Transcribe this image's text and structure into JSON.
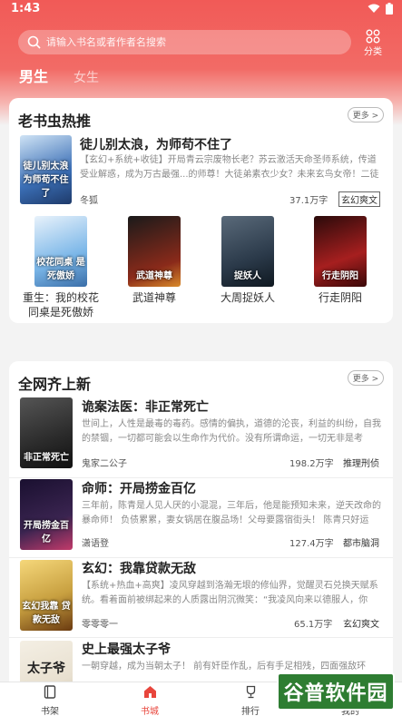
{
  "status": {
    "time": "1:43"
  },
  "search": {
    "placeholder": "请输入书名或者作者名搜索"
  },
  "category": {
    "label": "分类"
  },
  "tabs": {
    "male": "男生",
    "female": "女生"
  },
  "section1": {
    "title": "老书虫热推",
    "more": "更多 >",
    "featured": {
      "title": "徒儿别太浪，为师苟不住了",
      "cover_text": "徒儿别太浪 为师苟不住了",
      "desc": "【玄幻+系统+收徒】开局青云宗废物长老？苏云激活天命圣师系统，传道受业解惑，成为万古最强...的师尊！大徒弟素衣少女？未来玄鸟女帝！二徒弟...",
      "author": "冬狐",
      "words": "37.1万字",
      "genre": "玄幻爽文",
      "accent": "#3b6fb6"
    },
    "grid": [
      {
        "title": "重生：我的校花同桌是死傲娇",
        "cover_text": "校花同桌 是死傲娇",
        "color": "#7ab6e8"
      },
      {
        "title": "武道神尊",
        "cover_text": "武道神尊",
        "color": "#8a2a1a"
      },
      {
        "title": "大周捉妖人",
        "cover_text": "捉妖人",
        "color": "#2b3a4a"
      },
      {
        "title": "行走阴阳",
        "cover_text": "行走阴阳",
        "color": "#a61f1f"
      }
    ]
  },
  "section2": {
    "title": "全网齐上新",
    "more": "更多 >",
    "books": [
      {
        "title": "诡案法医：非正常死亡",
        "cover_text": "非正常死亡",
        "desc": "世间上，人性是最毒的毒药。感情的偏执，道德的沦丧，利益的纠纷，自我的禁锢，一切都可能会以生命作为代价。没有所谓命运，一切无非是考验、...",
        "author": "鬼家二公子",
        "words": "198.2万字",
        "genre": "推理刑侦",
        "color": "#2a2a2a"
      },
      {
        "title": "命师：开局捞金百亿",
        "cover_text": "开局捞金百亿",
        "desc": "三年前，陈青是人见人厌的小混混，三年后，他是能预知未来，逆天改命的暴命师！ 负债累累，妻女锅居在腹品场！父母要露宿街头！ 陈青只好运用...",
        "author": "潇语登",
        "words": "127.4万字",
        "genre": "都市脑洞",
        "color": "#3a2450"
      },
      {
        "title": "玄幻：我靠贷款无敌",
        "cover_text": "玄幻我靠 贷款无敌",
        "desc": "【系统+热血+高爽】凌风穿越到洛瀚无垠的修仙界，觉醒灵石兑换天赋系统。看着面前被绑起来的人质露出阴沉微笑：“我凌风向来以德服人，你给...",
        "author": "零零零一",
        "words": "65.1万字",
        "genre": "玄幻爽文",
        "color": "#c8a040"
      },
      {
        "title": "史上最强太子爷",
        "cover_text": "太子爷",
        "desc": "一朝穿越，成为当朝太子！ 前有奸臣作乱，后有手足相残，四面强敌环伺，",
        "color": "#e8e0d0"
      }
    ]
  },
  "nav": {
    "shelf": "书架",
    "store": "书城",
    "rank": "排行",
    "mine": "我的"
  },
  "watermark": {
    "text": "谷普软件园"
  },
  "colors": {
    "accent": "#f15a57",
    "nav_active": "#e8453c"
  }
}
